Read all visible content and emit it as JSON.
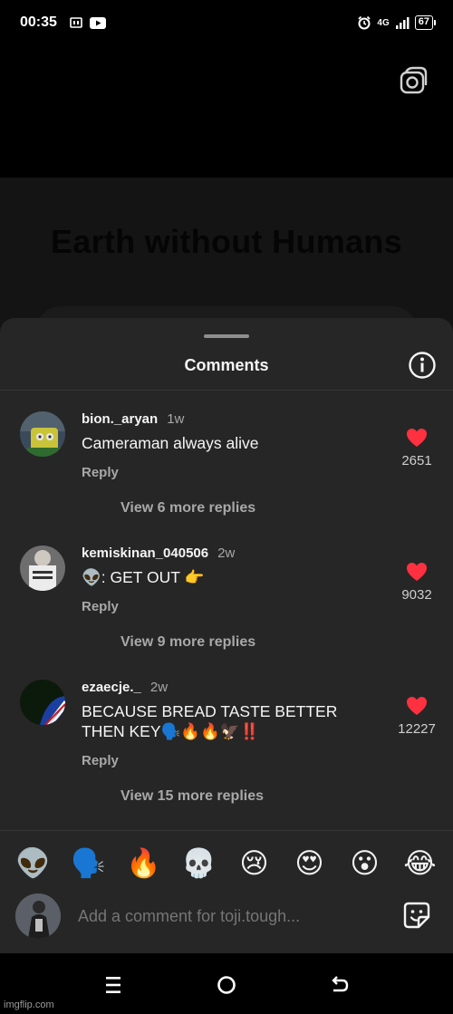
{
  "status_bar": {
    "time": "00:35",
    "network": "4G",
    "battery": "67"
  },
  "video": {
    "title": "Earth without Humans"
  },
  "sheet": {
    "title": "Comments"
  },
  "comments": [
    {
      "username": "bion._aryan",
      "time": "1w",
      "text": "Cameraman always alive",
      "reply_label": "Reply",
      "likes": "2651",
      "view_replies": "View 6 more replies"
    },
    {
      "username": "kemiskinan_040506",
      "time": "2w",
      "text": "👽: GET OUT 👉",
      "reply_label": "Reply",
      "likes": "9032",
      "view_replies": "View 9 more replies"
    },
    {
      "username": "ezaecje._",
      "time": "2w",
      "text": "BECAUSE BREAD TASTE BETTER THEN KEY🗣️🔥🔥🦅‼️",
      "reply_label": "Reply",
      "likes": "12227",
      "view_replies": "View 15 more replies"
    }
  ],
  "emoji_bar": [
    "👽",
    "🗣️",
    "🔥",
    "💀",
    "😢",
    "😍",
    "😮",
    "😂"
  ],
  "input": {
    "placeholder": "Add a comment for toji.tough..."
  },
  "watermark": "imgflip.com",
  "colors": {
    "heart": "#ff3040",
    "sheet_bg": "#262626",
    "muted_text": "#a8a8a8"
  }
}
